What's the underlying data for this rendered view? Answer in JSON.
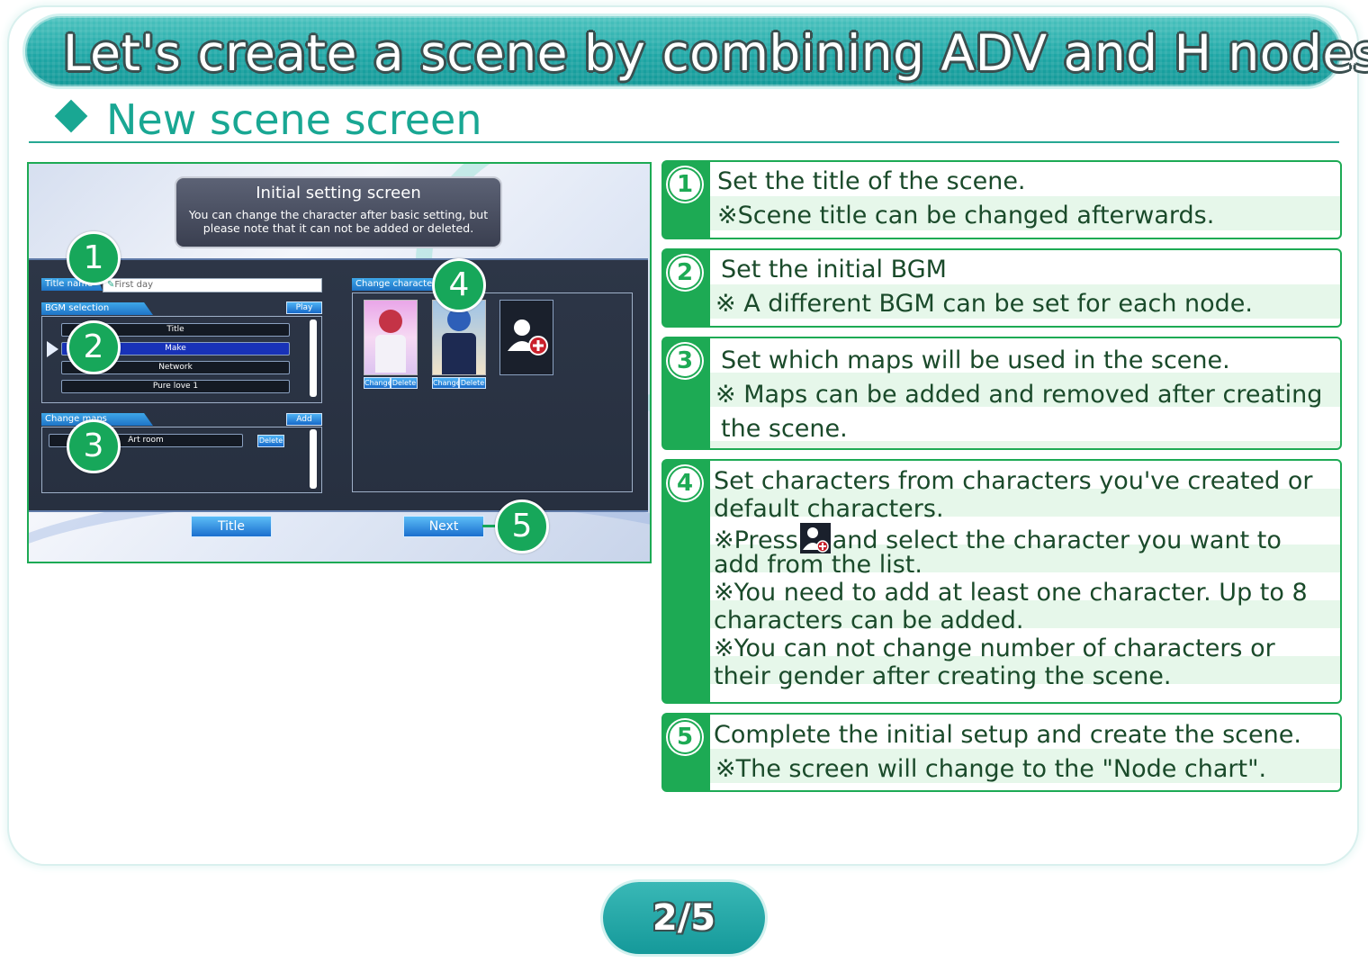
{
  "header": {
    "title": "Let's create a scene by combining ADV and H nodes!",
    "subtitle": "New scene screen"
  },
  "screenshot": {
    "init_title": "Initial setting screen",
    "init_desc_1": "You can change the character after basic setting, but",
    "init_desc_2": "please note that it can not be added or deleted.",
    "title_name_label": "Title name",
    "title_name_value": "First day",
    "bgm_label": "BGM selection",
    "play_label": "Play",
    "bgm_items": [
      "Title",
      "Make",
      "Network",
      "Pure love 1"
    ],
    "bgm_selected": "Make",
    "maps_label": "Change maps",
    "add_label": "Add",
    "map_item": "Art room",
    "map_delete": "Delete",
    "chars_label": "Change characters",
    "char_change": "Change",
    "char_delete": "Delete",
    "title_button": "Title",
    "next_button": "Next",
    "markers": [
      "1",
      "2",
      "3",
      "4",
      "5"
    ]
  },
  "steps": [
    {
      "num": "1",
      "lines": [
        "Set the title of the scene.",
        "※Scene title can be changed afterwards."
      ]
    },
    {
      "num": "2",
      "lines": [
        "Set the initial BGM",
        "※ A different BGM can be set for each node."
      ]
    },
    {
      "num": "3",
      "lines": [
        "Set which maps will be used in the scene.",
        "※ Maps can be added and removed after creating",
        "the scene."
      ]
    },
    {
      "num": "4",
      "lines": [
        "Set characters from characters you've created or",
        "default characters.",
        "※Press",
        "and select the character you want to",
        "add from the list.",
        "※You need to add at least one character. Up to 8",
        "characters can be added.",
        "※You can not change number of characters or",
        "their gender after creating the scene."
      ]
    },
    {
      "num": "5",
      "lines": [
        "Complete the initial setup and create the scene.",
        "※The screen will change to the \"Node chart\"."
      ]
    }
  ],
  "pager": {
    "text": "2/5"
  },
  "colors": {
    "teal": "#1fa7a6",
    "green": "#1daa54",
    "heading": "#19a793"
  }
}
